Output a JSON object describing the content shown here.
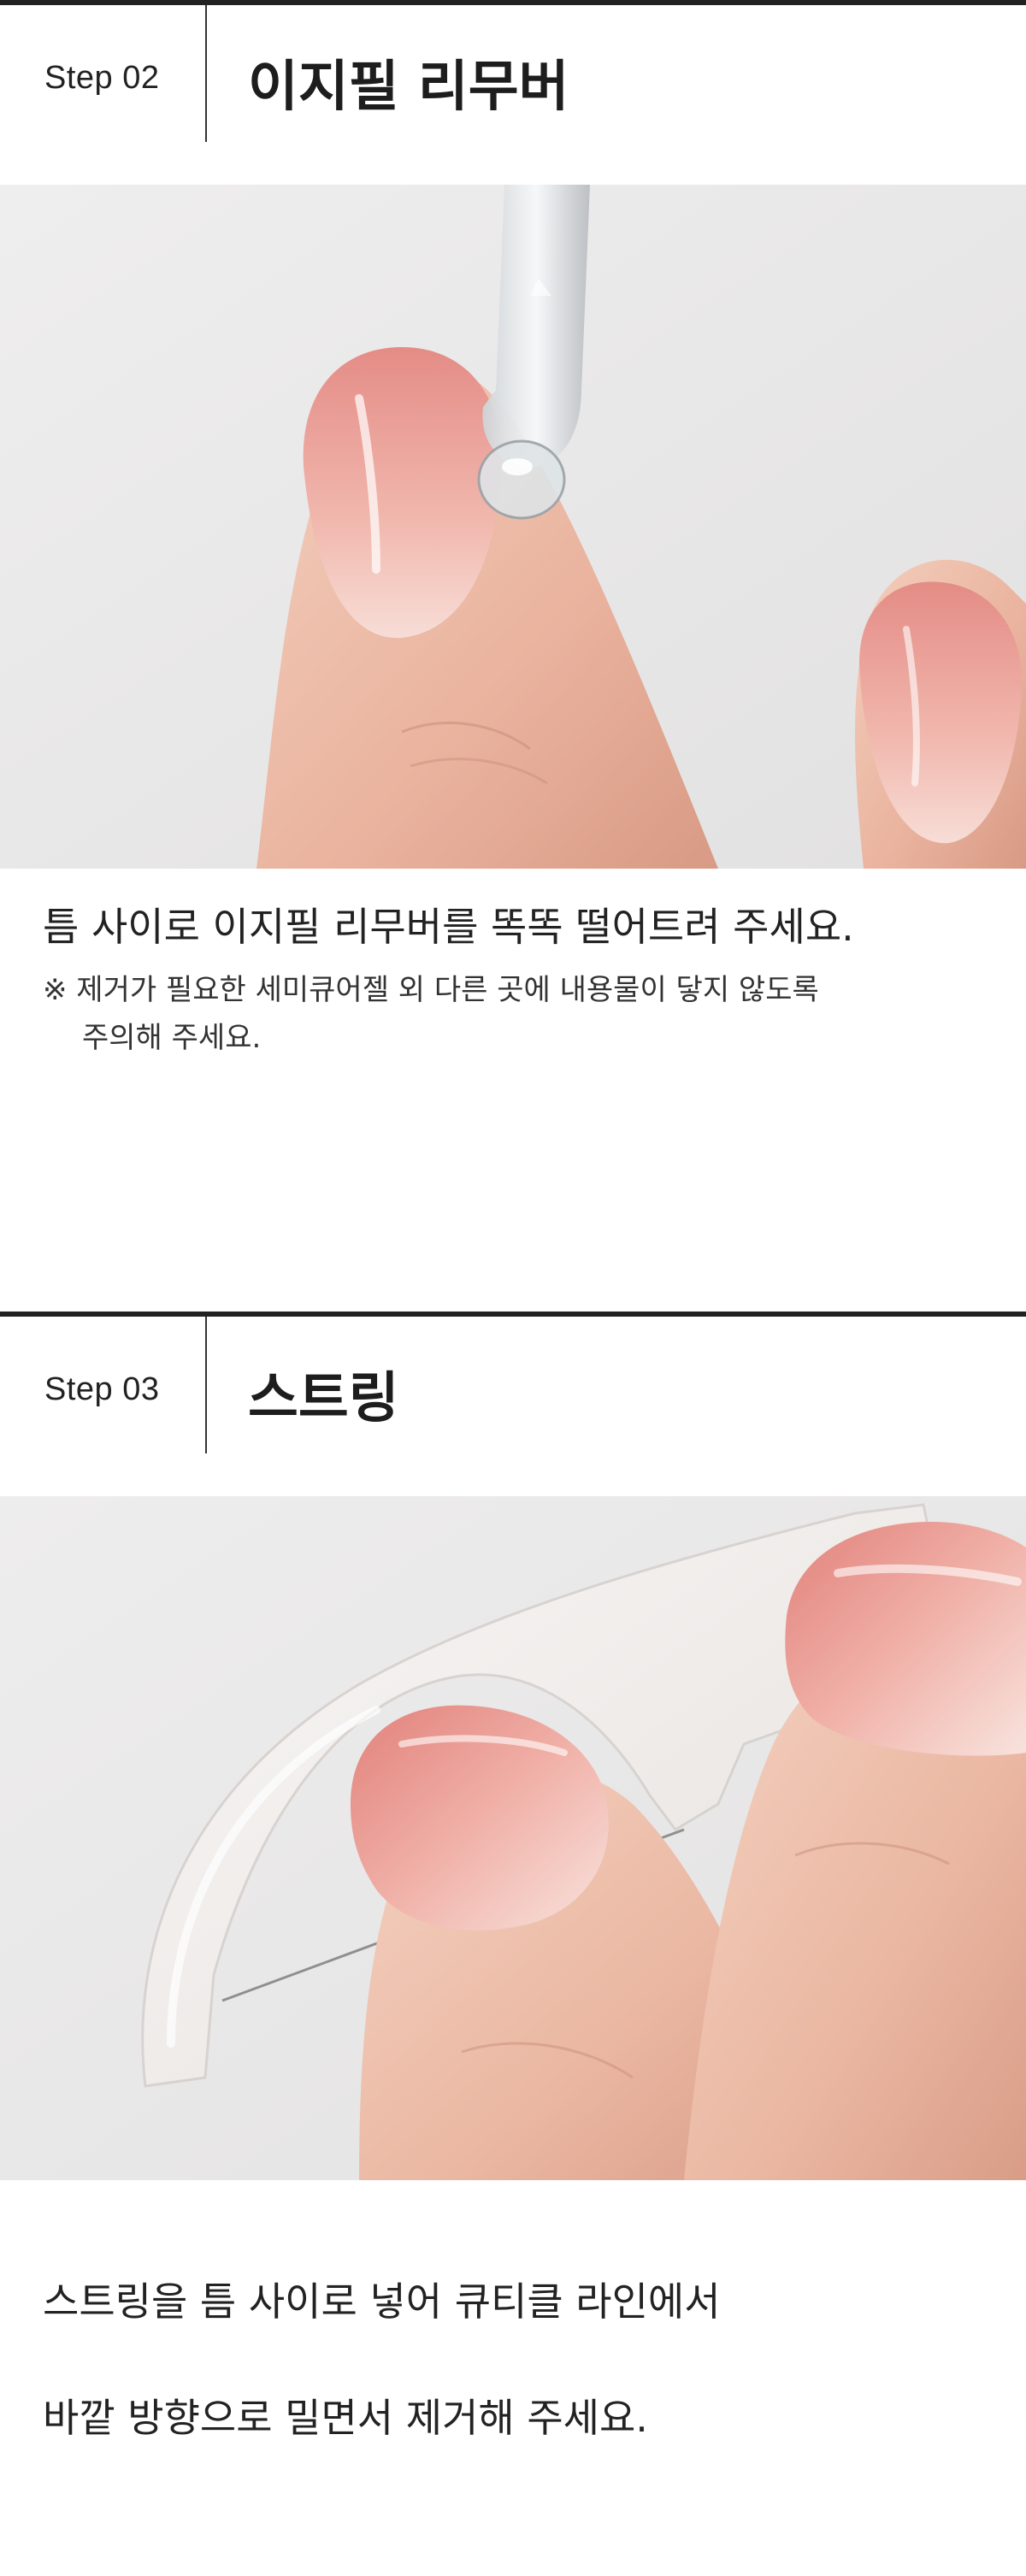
{
  "step2": {
    "label": "Step 02",
    "title": "이지필 리무버",
    "caption": "틈 사이로 이지필 리무버를 똑똑 떨어트려 주세요.",
    "note_line1": "※ 제거가 필요한 세미큐어젤 외 다른 곳에 내용물이 닿지 않도록",
    "note_line2": "주의해 주세요."
  },
  "step3": {
    "label": "Step 03",
    "title": "스트링",
    "caption_line1": "스트링을 틈 사이로 넣어 큐티클 라인에서",
    "caption_line2": "바깥 방향으로 밀면서 제거해 주세요."
  },
  "colors": {
    "skin": "#f0c2ae",
    "nail_pink": "#e8958f",
    "background": "#ecebeb",
    "text": "#222222"
  }
}
